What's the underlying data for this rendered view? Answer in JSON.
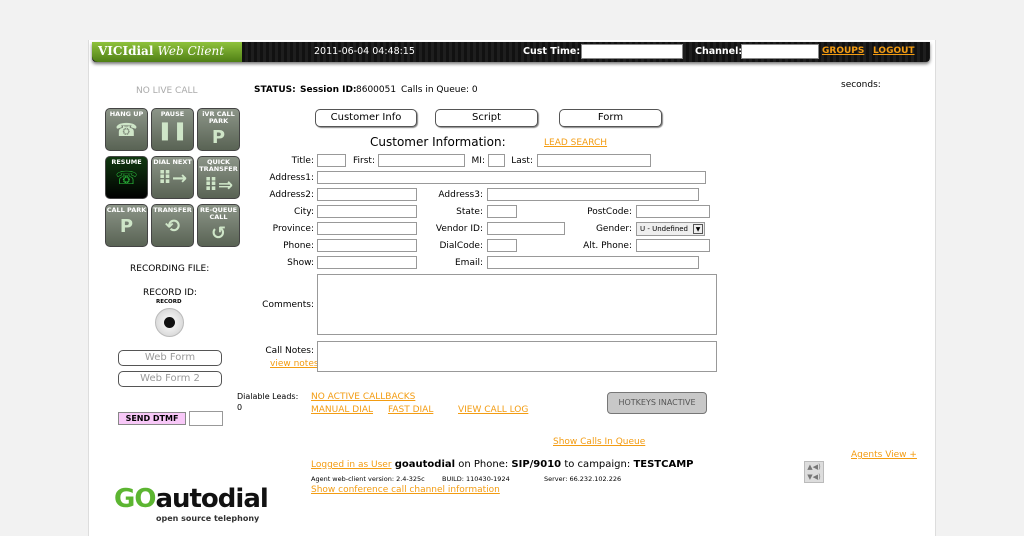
{
  "header": {
    "app_title": "VICIdial",
    "app_subtitle": "Web Client",
    "datetime": "2011-06-04 04:48:15",
    "cust_time_label": "Cust Time:",
    "channel_label": "Channel:",
    "groups_link": "GROUPS",
    "logout_link": "LOGOUT"
  },
  "status_bar": {
    "live_call": "NO LIVE CALL",
    "status_label": "STATUS:",
    "session_label": "Session ID:",
    "session_id": "8600051",
    "calls_in_queue": "Calls in Queue: 0",
    "seconds_label": "seconds:"
  },
  "call_buttons": [
    {
      "label": "HANG UP",
      "icon": "phone-icon"
    },
    {
      "label": "PAUSE",
      "icon": "pause-icon"
    },
    {
      "label": "iVR CALL PARK",
      "icon": "ivr-park-icon"
    },
    {
      "label": "RESUME",
      "icon": "resume-call-icon"
    },
    {
      "label": "DIAL NEXT",
      "icon": "dialpad-icon"
    },
    {
      "label": "QUICK TRANSFER",
      "icon": "quick-transfer-icon"
    },
    {
      "label": "CALL PARK",
      "icon": "park-icon"
    },
    {
      "label": "TRANSFER",
      "icon": "transfer-icon"
    },
    {
      "label": "RE-QUEUE CALL",
      "icon": "requeue-icon"
    }
  ],
  "tabs": [
    "Customer Info",
    "Script",
    "Form"
  ],
  "form": {
    "title": "Customer Information:",
    "lead_search": "LEAD SEARCH",
    "labels": {
      "title": "Title:",
      "first": "First:",
      "mi": "MI:",
      "last": "Last:",
      "address1": "Address1:",
      "address2": "Address2:",
      "address3": "Address3:",
      "city": "City:",
      "state": "State:",
      "postcode": "PostCode:",
      "province": "Province:",
      "vendor_id": "Vendor ID:",
      "gender": "Gender:",
      "phone": "Phone:",
      "dialcode": "DialCode:",
      "alt_phone": "Alt. Phone:",
      "show": "Show:",
      "email": "Email:",
      "comments": "Comments:",
      "call_notes": "Call Notes:"
    },
    "gender_value": "U - Undefined",
    "view_notes": "view notes"
  },
  "recording": {
    "file_label": "RECORDING FILE:",
    "id_label": "RECORD ID:",
    "record_label": "RECORD"
  },
  "web_form": "Web Form",
  "web_form2": "Web Form 2",
  "send_dtmf": "SEND DTMF",
  "dialable": {
    "label": "Dialable Leads:",
    "value": "0"
  },
  "links": {
    "callbacks": "NO ACTIVE CALLBACKS",
    "manual_dial": "MANUAL DIAL",
    "fast_dial": "FAST DIAL",
    "view_call_log": "VIEW CALL LOG",
    "show_calls_queue": "Show Calls In Queue",
    "agents_view": "Agents View +",
    "logged_in": "Logged in as User",
    "conference_info": "Show conference call channel information"
  },
  "hotkeys": "HOTKEYS INACTIVE",
  "footer": {
    "user": "goautodial",
    "on_phone": "on Phone:",
    "phone": "SIP/9010",
    "to_campaign": "to campaign:",
    "campaign": "TESTCAMP",
    "version": "Agent web-client version: 2.4-325c",
    "build": "BUILD: 110430-1924",
    "server": "Server: 66.232.102.226"
  },
  "brand": {
    "logo_go": "GO",
    "logo_rest": "autodial",
    "tagline": "open source telephony"
  }
}
